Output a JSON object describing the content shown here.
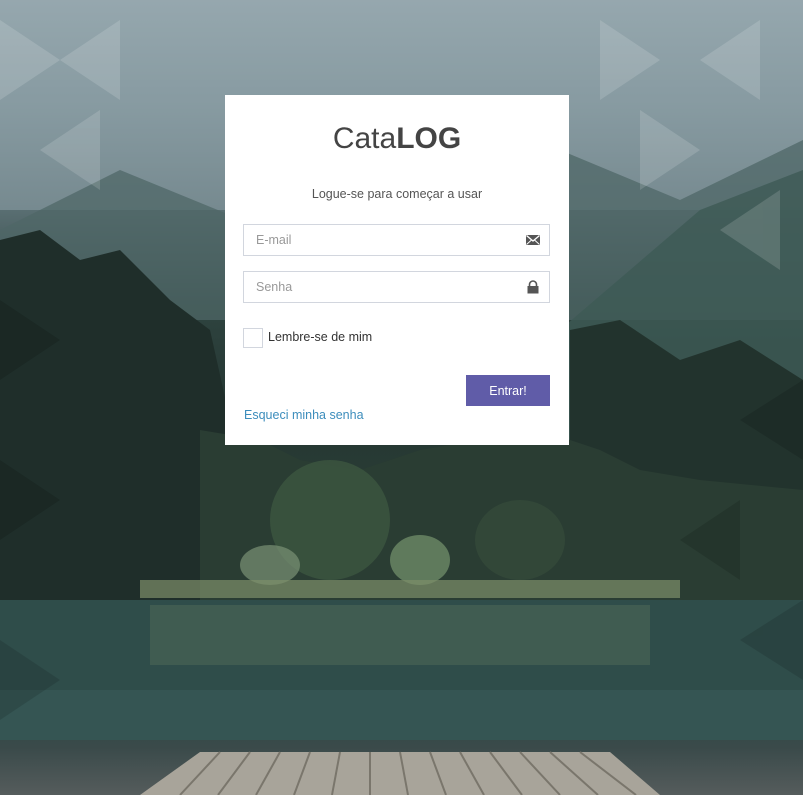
{
  "brand": {
    "light": "Cata",
    "bold": "LOG"
  },
  "login": {
    "subtitle": "Logue-se para começar a usar",
    "email_placeholder": "E-mail",
    "password_placeholder": "Senha",
    "remember_label": "Lembre-se de mim",
    "submit_label": "Entrar!",
    "forgot_label": "Esqueci minha senha"
  },
  "icons": {
    "email": "envelope-icon",
    "password": "lock-icon"
  },
  "colors": {
    "accent": "#605ca8",
    "link": "#3c8dbc",
    "card": "#ffffff",
    "input_border": "#d2d6de"
  }
}
